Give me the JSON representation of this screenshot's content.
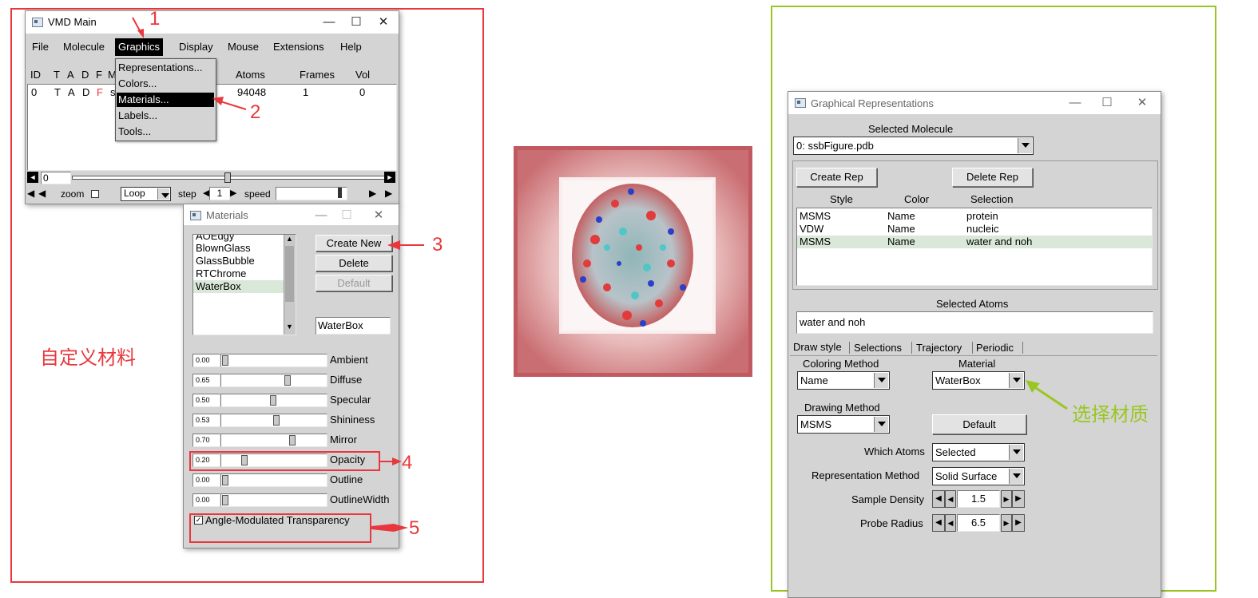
{
  "vmd_main": {
    "title": "VMD Main",
    "menu": [
      "File",
      "Molecule",
      "Graphics",
      "Display",
      "Mouse",
      "Extensions",
      "Help"
    ],
    "columns": [
      "ID",
      "T",
      "A",
      "D",
      "F",
      "M",
      "Atoms",
      "Frames",
      "Vol"
    ],
    "row": {
      "id": "0",
      "t": "T",
      "a": "A",
      "d": "D",
      "f": "F",
      "m": "s",
      "atoms": "94048",
      "frames": "1",
      "vol": "0"
    },
    "frame_value": "0",
    "zoom_label": "zoom",
    "loop_label": "Loop",
    "step_label": "step",
    "step_value": "1",
    "speed_label": "speed"
  },
  "graphics_menu": {
    "items": [
      "Representations...",
      "Colors...",
      "Materials...",
      "Labels...",
      "Tools..."
    ],
    "highlighted": "Materials..."
  },
  "materials": {
    "title": "Materials",
    "list": [
      "AOEdgy",
      "BlownGlass",
      "GlassBubble",
      "RTChrome",
      "WaterBox"
    ],
    "selected": "WaterBox",
    "buttons": {
      "create_new": "Create New",
      "delete": "Delete",
      "default": "Default"
    },
    "name_field": "WaterBox",
    "sliders": [
      {
        "label": "Ambient",
        "value": "0.00",
        "level": 0.0
      },
      {
        "label": "Diffuse",
        "value": "0.65",
        "level": 0.65
      },
      {
        "label": "Specular",
        "value": "0.50",
        "level": 0.5
      },
      {
        "label": "Shininess",
        "value": "0.53",
        "level": 0.53
      },
      {
        "label": "Mirror",
        "value": "0.70",
        "level": 0.7
      },
      {
        "label": "Opacity",
        "value": "0.20",
        "level": 0.2
      },
      {
        "label": "Outline",
        "value": "0.00",
        "level": 0.0
      },
      {
        "label": "OutlineWidth",
        "value": "0.00",
        "level": 0.0
      }
    ],
    "checkbox_label": "Angle-Modulated Transparency",
    "checkbox_checked": true
  },
  "annotations": {
    "n1": "1",
    "n2": "2",
    "n3": "3",
    "n4": "4",
    "n5": "5",
    "left_caption": "自定义材料",
    "right_caption": "选择材质",
    "red_color": "#e8383d",
    "green_color": "#9ac623"
  },
  "graphical_reps": {
    "title": "Graphical Representations",
    "selected_molecule_label": "Selected Molecule",
    "selected_molecule": "0: ssbFigure.pdb",
    "create_rep": "Create Rep",
    "delete_rep": "Delete Rep",
    "columns": [
      "Style",
      "Color",
      "Selection"
    ],
    "reps": [
      {
        "style": "MSMS",
        "color": "Name",
        "selection": "protein"
      },
      {
        "style": "VDW",
        "color": "Name",
        "selection": "nucleic"
      },
      {
        "style": "MSMS",
        "color": "Name",
        "selection": "water and noh"
      }
    ],
    "selected_atoms_label": "Selected Atoms",
    "selected_atoms": "water and noh",
    "tabs": [
      "Draw style",
      "Selections",
      "Trajectory",
      "Periodic"
    ],
    "coloring_method_label": "Coloring Method",
    "coloring_method": "Name",
    "material_label": "Material",
    "material": "WaterBox",
    "drawing_method_label": "Drawing Method",
    "drawing_method": "MSMS",
    "default_button": "Default",
    "which_atoms_label": "Which Atoms",
    "which_atoms": "Selected",
    "rep_method_label": "Representation Method",
    "rep_method": "Solid Surface",
    "sample_density_label": "Sample Density",
    "sample_density": "1.5",
    "probe_radius_label": "Probe Radius",
    "probe_radius": "6.5"
  }
}
